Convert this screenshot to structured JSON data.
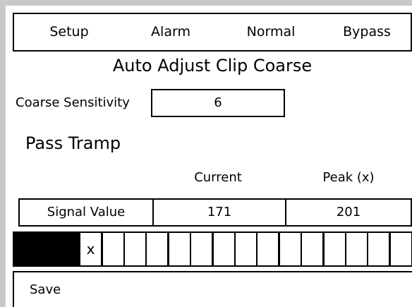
{
  "menu": {
    "setup": "Setup",
    "alarm": "Alarm",
    "normal": "Normal",
    "bypass": "Bypass"
  },
  "title": "Auto Adjust Clip Coarse",
  "coarse_sensitivity": {
    "label": "Coarse Sensitivity",
    "value": "6"
  },
  "section_title": "Pass Tramp",
  "table": {
    "headers": {
      "current": "Current",
      "peak": "Peak (x)"
    },
    "row": {
      "label": "Signal Value",
      "current": "171",
      "peak": "201"
    }
  },
  "signal_bar": {
    "segments_total": 18,
    "filled_segments": 3,
    "peak_marker_segment": 4,
    "peak_marker_text": "x"
  },
  "footer": {
    "save_label": "Save"
  }
}
